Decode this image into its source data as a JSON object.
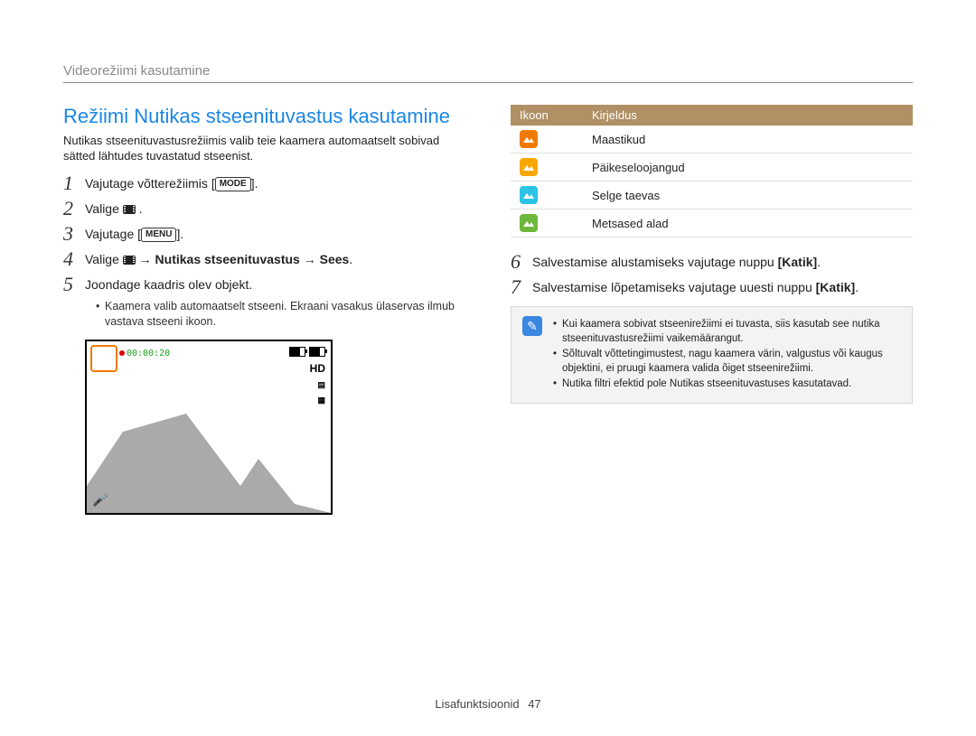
{
  "breadcrumb": "Videorežiimi kasutamine",
  "title": "Režiimi Nutikas stseenituvastus kasutamine",
  "intro": "Nutikas stseenituvastusrežiimis valib teie kaamera automaatselt sobivad sätted lähtudes tuvastatud stseenist.",
  "steps_left": [
    {
      "num": "1",
      "prefix": "Vajutage võtterežiimis ",
      "button": "MODE",
      "suffix": "."
    },
    {
      "num": "2",
      "prefix": "Valige ",
      "film": true,
      "suffix": " ."
    },
    {
      "num": "3",
      "prefix": "Vajutage ",
      "button": "MENU",
      "suffix": "."
    },
    {
      "num": "4",
      "prefix": "Valige ",
      "film": true,
      "bold_after": " → Nutikas stseenituvastus → Sees",
      "suffix": "."
    },
    {
      "num": "5",
      "prefix": "Joondage kaadris olev objekt.",
      "sub": "Kaamera valib automaatselt stseeni. Ekraani vasakus ülaservas ilmub vastava stseeni ikoon."
    }
  ],
  "preview": {
    "timer": "00:00:20",
    "hd": "HD"
  },
  "table": {
    "head_icon": "Ikoon",
    "head_desc": "Kirjeldus",
    "rows": [
      {
        "color": "chip-orange",
        "label": "Maastikud"
      },
      {
        "color": "chip-amber",
        "label": "Päikeseloojangud"
      },
      {
        "color": "chip-cyan",
        "label": "Selge taevas"
      },
      {
        "color": "chip-green",
        "label": "Metsased alad"
      }
    ]
  },
  "steps_right": [
    {
      "num": "6",
      "prefix": "Salvestamise alustamiseks vajutage nuppu ",
      "bold": "[Katik]",
      "suffix": "."
    },
    {
      "num": "7",
      "prefix": "Salvestamise lõpetamiseks vajutage uuesti nuppu ",
      "bold": "[Katik]",
      "suffix": "."
    }
  ],
  "notes": [
    "Kui kaamera sobivat stseenirežiimi ei tuvasta, siis kasutab see nutika stseenituvastusrežiimi vaikemäärangut.",
    "Sõltuvalt võttetingimustest, nagu kaamera värin, valgustus või kaugus objektini, ei pruugi kaamera valida õiget stseenirežiimi.",
    "Nutika filtri efektid pole Nutikas stseenituvastuses kasutatavad."
  ],
  "footer_label": "Lisafunktsioonid",
  "footer_page": "47"
}
